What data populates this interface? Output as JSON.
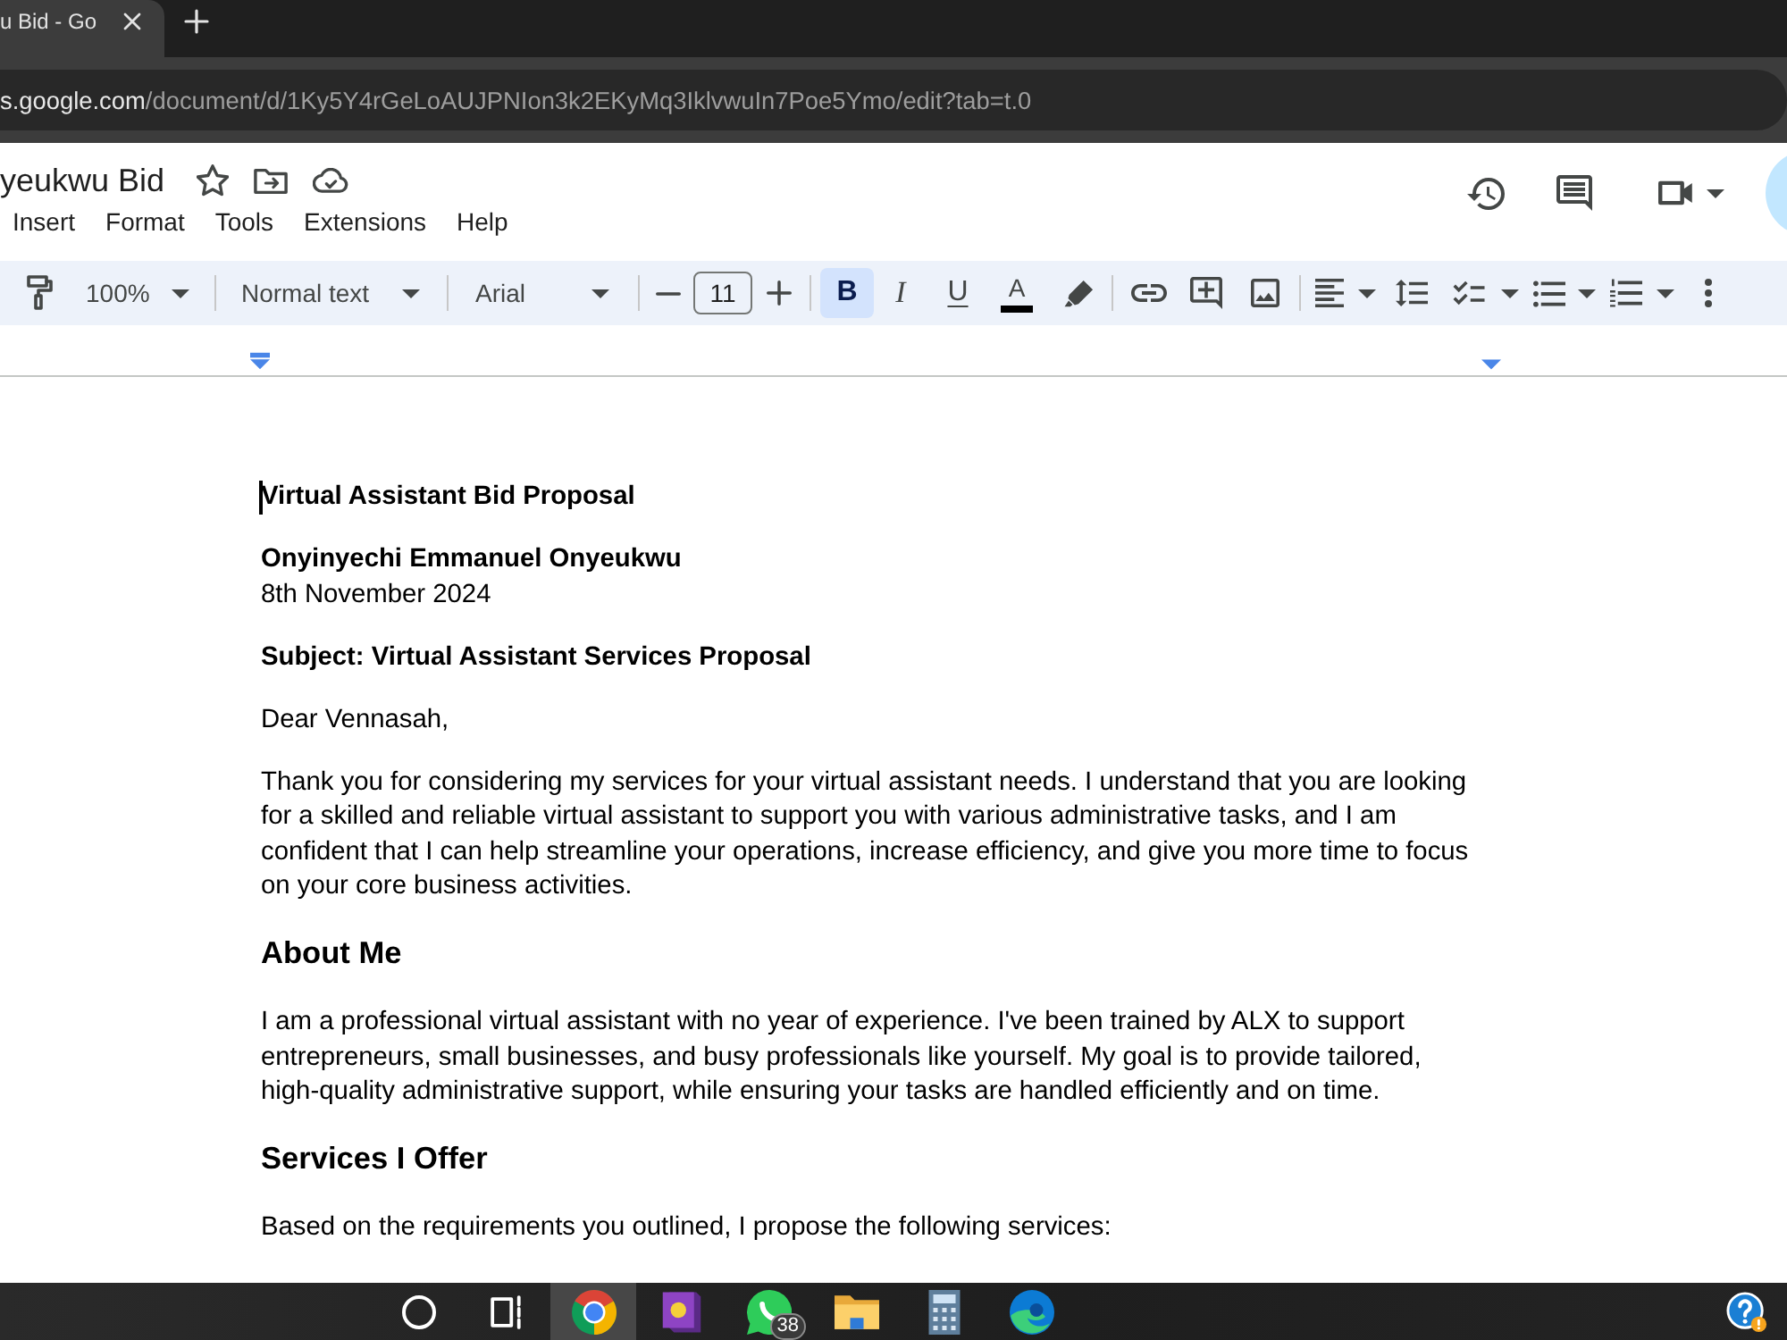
{
  "browser": {
    "tab": {
      "title": "u Bid - Go",
      "selected": true
    },
    "address": {
      "host": "s.google.com",
      "path": "/document/d/1Ky5Y4rGeLoAUJPNIon3k2EKyMq3IklvwuIn7Poe5Ymo/edit?tab=t.0"
    }
  },
  "document_header": {
    "title": "yeukwu Bid",
    "menu": [
      "Insert",
      "Format",
      "Tools",
      "Extensions",
      "Help"
    ]
  },
  "toolbar": {
    "items": [
      {
        "kind": "paint_format"
      },
      {
        "kind": "zoom",
        "label": "100%"
      },
      {
        "kind": "separator"
      },
      {
        "kind": "style",
        "label": "Normal text"
      },
      {
        "kind": "separator"
      },
      {
        "kind": "font",
        "label": "Arial"
      },
      {
        "kind": "separator"
      },
      {
        "kind": "decrease"
      },
      {
        "kind": "size",
        "value": "11"
      },
      {
        "kind": "increase"
      },
      {
        "kind": "separator"
      },
      {
        "kind": "bold",
        "label": "B",
        "selected": true
      },
      {
        "kind": "italic",
        "label": "I",
        "selected": false
      },
      {
        "kind": "underline",
        "label": "U",
        "selected": false
      },
      {
        "kind": "text_color",
        "label": "A"
      },
      {
        "kind": "highlight"
      },
      {
        "kind": "separator"
      },
      {
        "kind": "link"
      },
      {
        "kind": "comment"
      },
      {
        "kind": "image"
      },
      {
        "kind": "separator"
      },
      {
        "kind": "align"
      },
      {
        "kind": "line_spacing"
      },
      {
        "kind": "checklist"
      },
      {
        "kind": "bullets"
      },
      {
        "kind": "numbered"
      },
      {
        "kind": "more"
      }
    ]
  },
  "document": {
    "blocks": [
      {
        "kind": "title",
        "text": "Virtual Assistant Bid Proposal",
        "cursor": true
      },
      {
        "kind": "sender",
        "name": "Onyinyechi Emmanuel Onyeukwu",
        "date": "8th November 2024"
      },
      {
        "kind": "subject",
        "text": "Subject: Virtual Assistant Services Proposal"
      },
      {
        "kind": "text",
        "text": "Dear Vennasah,"
      },
      {
        "kind": "text",
        "text": "Thank you for considering my services for your virtual assistant needs. I understand that you are looking for a skilled and reliable virtual assistant to support you with various administrative tasks, and I am confident that I can help streamline your operations, increase efficiency, and give you more time to focus on your core business activities."
      },
      {
        "kind": "heading",
        "text": "About Me"
      },
      {
        "kind": "text",
        "text": "I am a professional virtual assistant with no year of experience. I've been trained by ALX to support entrepreneurs, small businesses, and busy professionals like yourself. My goal is to provide tailored, high-quality administrative support, while ensuring your tasks are handled efficiently and on time."
      },
      {
        "kind": "heading",
        "text": "Services I Offer"
      },
      {
        "kind": "text",
        "text": "Based on the requirements you outlined, I propose the following services:"
      }
    ]
  },
  "taskbar": {
    "apps": [
      {
        "kind": "ring",
        "selected": false
      },
      {
        "kind": "task_view",
        "selected": false
      },
      {
        "kind": "browser",
        "selected": true
      },
      {
        "kind": "book",
        "selected": false
      },
      {
        "kind": "chat",
        "selected": false,
        "badge": "38"
      },
      {
        "kind": "folder",
        "selected": false
      },
      {
        "kind": "calculator",
        "selected": false
      },
      {
        "kind": "swirl_browser",
        "selected": false
      }
    ],
    "tray": [
      {
        "kind": "help"
      }
    ]
  }
}
